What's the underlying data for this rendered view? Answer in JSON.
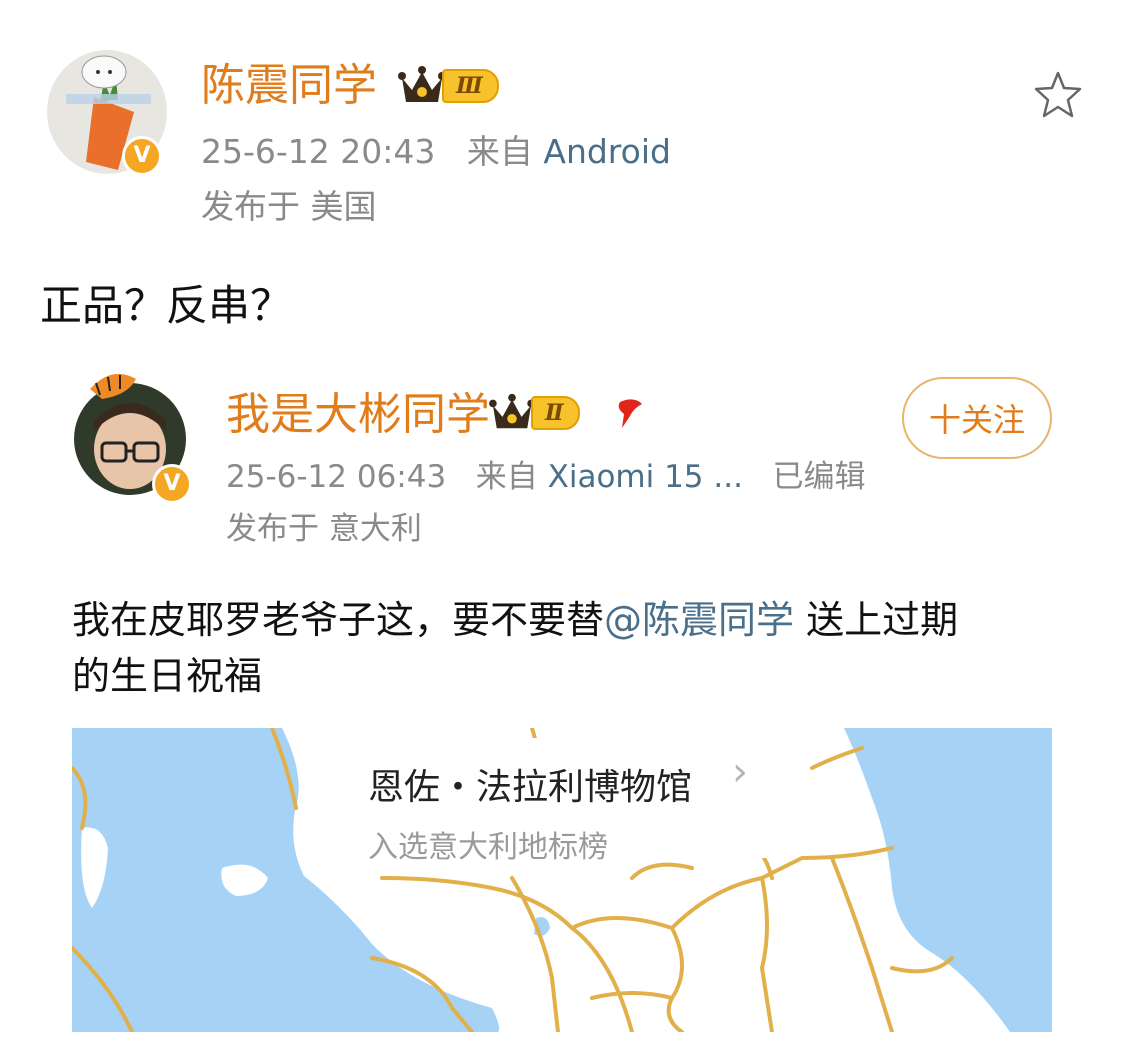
{
  "original_post": {
    "author": "陈震同学",
    "level": "Ⅲ",
    "timestamp": "25-6-12 20:43",
    "source_prefix": "来自",
    "source": "Android",
    "location": "发布于 美国",
    "text": "正品？反串？",
    "star_icon": "star-outline-icon"
  },
  "repost": {
    "author": "我是大彬同学",
    "level": "Ⅱ",
    "timestamp": "25-6-12 06:43",
    "source_prefix": "来自",
    "source": "Xiaomi 15 ...",
    "edited": "已编辑",
    "location": "发布于 意大利",
    "follow_label": "十关注",
    "text_before": "我在皮耶罗老爷子这，要不要替",
    "mention": "@陈震同学",
    "text_after": " 送上过期",
    "text_line2": "的生日祝福"
  },
  "map_card": {
    "title": "恩佐・法拉利博物馆",
    "chevron": "›",
    "subtitle": "入选意大利地标榜"
  },
  "colors": {
    "name_orange": "#e07c1a",
    "meta_gray": "#8a8a8a",
    "link_blue": "#4a6f8a",
    "water": "#a6d2f5",
    "road": "#e2b04a",
    "badge": "#f5a623"
  }
}
